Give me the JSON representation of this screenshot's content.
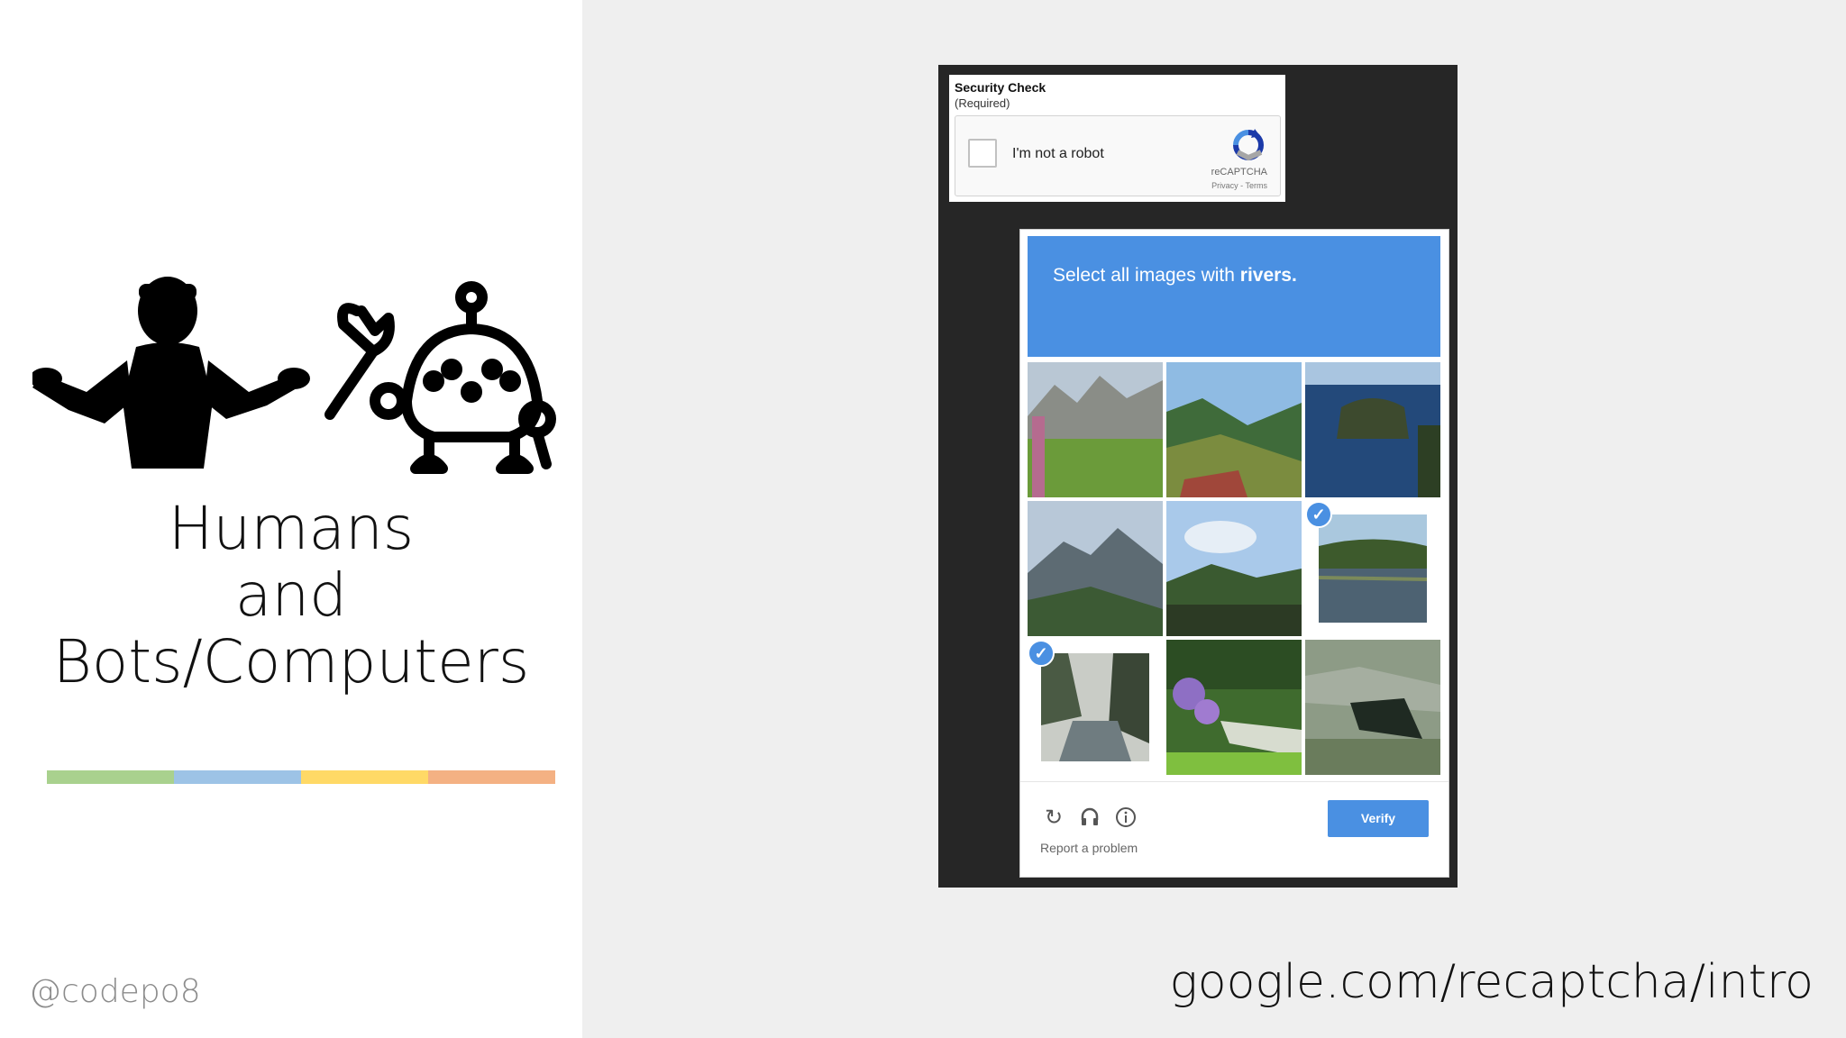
{
  "left": {
    "title_lines": [
      "Humans",
      "and",
      "Bots/Computers"
    ],
    "handle": "@codepo8",
    "color_bar": [
      "#a9d18e",
      "#9dc3e6",
      "#ffd966",
      "#f4b183"
    ],
    "illustration_icons": [
      "shrugging-person-icon",
      "robot-with-wrench-icon"
    ]
  },
  "right": {
    "url": "google.com/recaptcha/intro"
  },
  "captcha": {
    "security_title": "Security Check",
    "security_required": "(Required)",
    "checkbox_label": "I'm not a robot",
    "brand": "reCAPTCHA",
    "links": "Privacy - Terms",
    "challenge_prefix": "Select all images with ",
    "challenge_keyword": "rivers.",
    "tiles": [
      {
        "label": "mountain meadow",
        "selected": false
      },
      {
        "label": "green hills with roof",
        "selected": false
      },
      {
        "label": "island in sea",
        "selected": false
      },
      {
        "label": "mountain valley",
        "selected": false
      },
      {
        "label": "green hills",
        "selected": false
      },
      {
        "label": "river with trees",
        "selected": true
      },
      {
        "label": "canal with trees",
        "selected": true
      },
      {
        "label": "garden with flowers",
        "selected": false
      },
      {
        "label": "rocky stream",
        "selected": false
      }
    ],
    "footer_icons": [
      "reload-icon",
      "audio-icon",
      "info-icon"
    ],
    "report_label": "Report a problem",
    "verify_label": "Verify",
    "accent_color": "#4a90e2"
  }
}
